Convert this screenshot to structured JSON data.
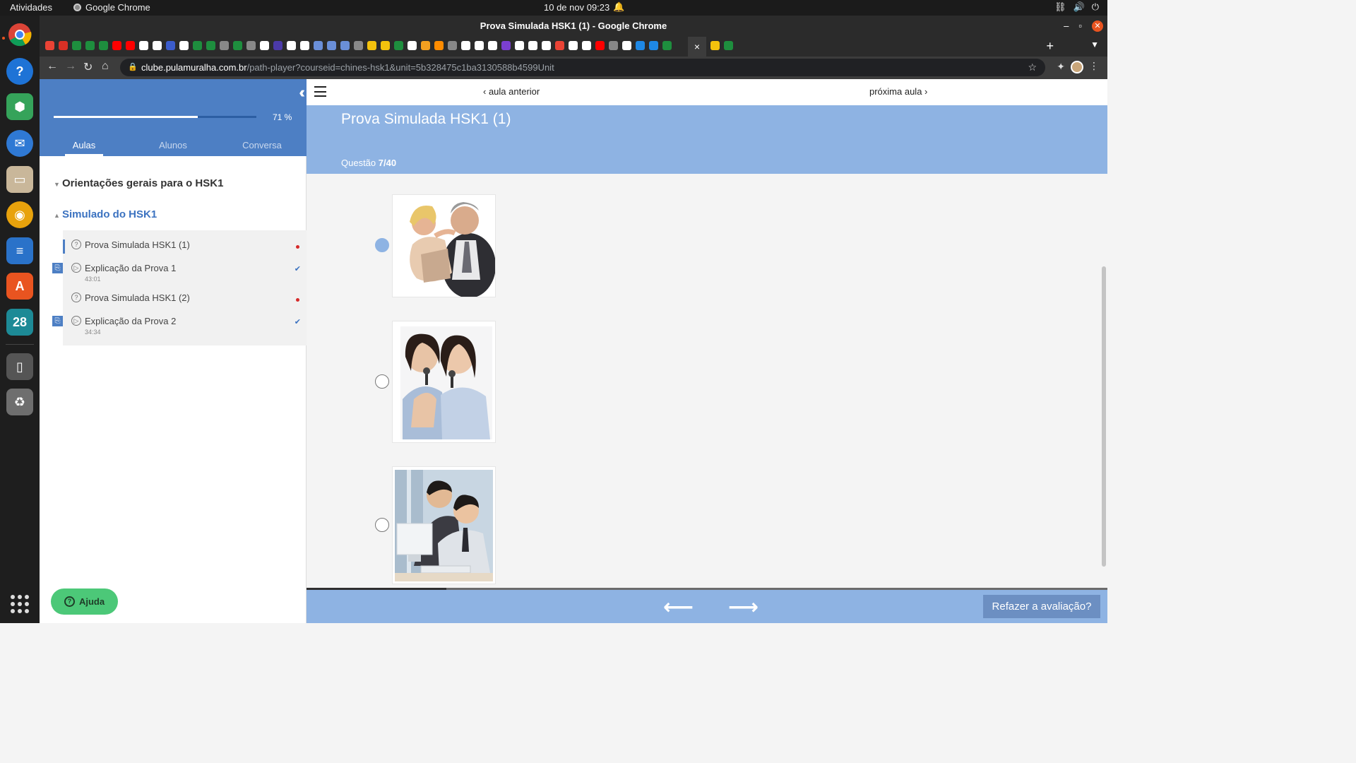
{
  "os": {
    "activities": "Atividades",
    "app_name": "Google Chrome",
    "clock": "10 de nov  09:23",
    "dock_items": [
      {
        "icon": "chrome-icon",
        "color": "#3c3c3c"
      },
      {
        "icon": "help-icon",
        "color": "#1e73d6"
      },
      {
        "icon": "blender-cube-icon",
        "color": "#35a35a"
      },
      {
        "icon": "thunderbird-icon",
        "color": "#2f79d4"
      },
      {
        "icon": "files-icon",
        "color": "#c9b79a"
      },
      {
        "icon": "rhythmbox-icon",
        "color": "#e8a20c"
      },
      {
        "icon": "writer-icon",
        "color": "#2a72c9"
      },
      {
        "icon": "app-store-icon",
        "color": "#e95420"
      },
      {
        "icon": "calendar-icon",
        "color": "#1d8a96",
        "text": "28"
      },
      {
        "icon": "drive-icon",
        "color": "#555555"
      },
      {
        "icon": "trash-icon",
        "color": "#6e6e6e"
      }
    ]
  },
  "browser": {
    "window_title": "Prova Simulada HSK1 (1) - Google Chrome",
    "url_host": "clube.pulamuralha.com.br",
    "url_path": "/path-player?courseid=chines-hsk1&unit=5b328475c1ba3130588b4599Unit",
    "active_tab_close": "×",
    "new_tab": "+",
    "tab_colors": [
      "#ea4335",
      "#d93025",
      "#1e8e3e",
      "#1e8e3e",
      "#1e8e3e",
      "#ff0000",
      "#ff0000",
      "#ffffff",
      "#ffffff",
      "#3b5ccc",
      "#ffffff",
      "#1e8e3e",
      "#1e8e3e",
      "#888888",
      "#1e8e3e",
      "#888888",
      "#ffffff",
      "#4b3aa8",
      "#ffffff",
      "#ffffff",
      "#6a8fd8",
      "#6a8fd8",
      "#6a8fd8",
      "#888888",
      "#f4c20d",
      "#f4c20d",
      "#1e8e3e",
      "#ffffff",
      "#f4a020",
      "#ff8c00",
      "#888888",
      "#ffffff",
      "#ffffff",
      "#ffffff",
      "#7b3fd0",
      "#ffffff",
      "#ffffff",
      "#ffffff",
      "#ea4335",
      "#ffffff",
      "#ffffff",
      "#ff0000",
      "#888888",
      "#ffffff",
      "#1e88e5",
      "#1e88e5",
      "#1e8e3e",
      "#1e8e3e",
      "#f4c20d",
      "#1e8e3e"
    ]
  },
  "sidebar": {
    "progress_value": 0.71,
    "progress_label": "71 %",
    "tabs": [
      {
        "label": "Aulas"
      },
      {
        "label": "Alunos"
      },
      {
        "label": "Conversa"
      }
    ],
    "sections": [
      {
        "title": "Orientações gerais para o HSK1"
      },
      {
        "title": "Simulado do HSK1"
      }
    ],
    "lessons": [
      {
        "title": "Prova Simulada HSK1 (1)",
        "duration": "",
        "status": "pending"
      },
      {
        "title": "Explicação da Prova 1",
        "duration": "43:01",
        "status": "done"
      },
      {
        "title": "Prova Simulada HSK1 (2)",
        "duration": "",
        "status": "pending"
      },
      {
        "title": "Explicação da Prova 2",
        "duration": "34:34",
        "status": "done"
      }
    ],
    "help_label": "Ajuda"
  },
  "content": {
    "prev_label": "aula anterior",
    "next_label": "próxima aula",
    "title": "Prova Simulada HSK1 (1)",
    "question_prefix": "Questão",
    "question_number": "7/40",
    "options": [
      {
        "image": "couple-dancing-photo",
        "selected": true
      },
      {
        "image": "girls-singing-karaoke-photo",
        "selected": false
      },
      {
        "image": "men-at-computer-photo",
        "selected": false
      }
    ],
    "question_progress": 0.175,
    "redo_label": "Refazer a avaliação?"
  }
}
